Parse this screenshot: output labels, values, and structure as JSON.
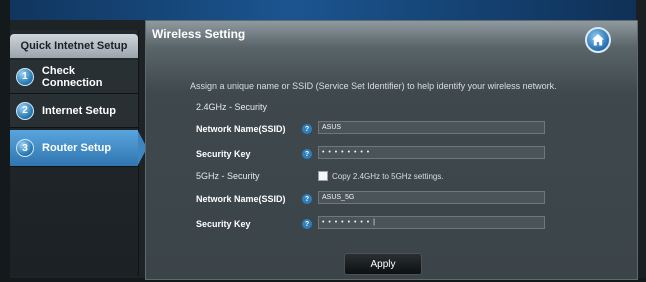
{
  "sidebar": {
    "header": "Quick Intetnet Setup",
    "steps": [
      {
        "number": "1",
        "label": "Check Connection"
      },
      {
        "number": "2",
        "label": "Internet Setup"
      },
      {
        "number": "3",
        "label": "Router Setup"
      }
    ]
  },
  "main": {
    "title": "Wireless Setting",
    "home_icon": "home-icon",
    "description": "Assign a unique name or SSID (Service Set Identifier) to help identify your wireless network.",
    "band_24": {
      "heading": "2.4GHz - Security",
      "ssid_label": "Network Name(SSID)",
      "ssid_value": "ASUS",
      "key_label": "Security Key",
      "key_value": "• • • • • • • •"
    },
    "band_5": {
      "heading": "5GHz - Security",
      "copy_label": "Copy 2.4GHz to 5GHz settings.",
      "ssid_label": "Network Name(SSID)",
      "ssid_value": "ASUS_5G",
      "key_label": "Security Key",
      "key_value": "• • • • • • • • |"
    },
    "help_mark": "?",
    "apply_label": "Apply"
  },
  "colors": {
    "accent": "#3d86c2",
    "panel_bg": "#3b4448",
    "sidebar_bg": "#22292c"
  }
}
